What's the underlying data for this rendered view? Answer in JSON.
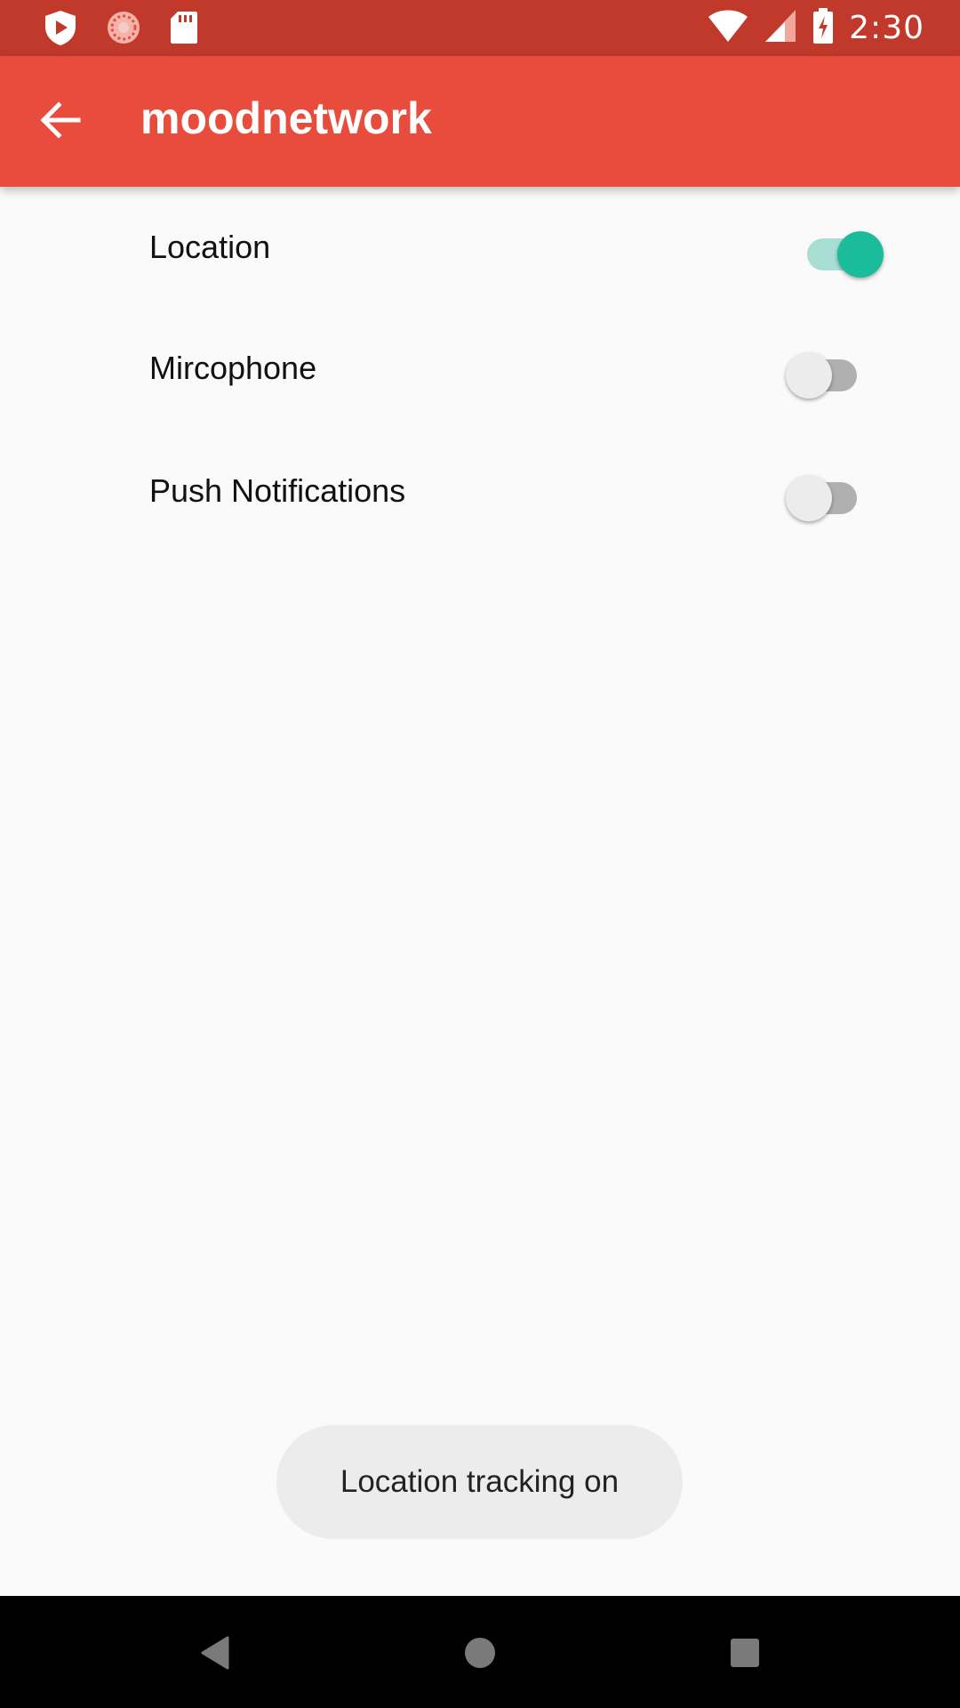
{
  "status_bar": {
    "time": "2:30",
    "left_icons": [
      "play-shield-icon",
      "settings-gear-icon",
      "sd-card-icon"
    ],
    "right_icons": [
      "wifi-icon",
      "signal-icon",
      "battery-charging-icon"
    ]
  },
  "app_bar": {
    "title": "moodnetwork",
    "back_icon": "arrow-back-icon"
  },
  "settings": [
    {
      "label": "Location",
      "enabled": true
    },
    {
      "label": "Mircophone",
      "enabled": false
    },
    {
      "label": "Push Notifications",
      "enabled": false
    }
  ],
  "toast": {
    "message": "Location tracking on"
  },
  "nav_bar": {
    "buttons": [
      "back-triangle-icon",
      "home-circle-icon",
      "recents-square-icon"
    ]
  },
  "colors": {
    "status_bar": "#c0392b",
    "app_bar": "#e74c3c",
    "switch_on": "#1abc9c",
    "switch_on_track": "#a8ded4",
    "background": "#fafafa"
  }
}
